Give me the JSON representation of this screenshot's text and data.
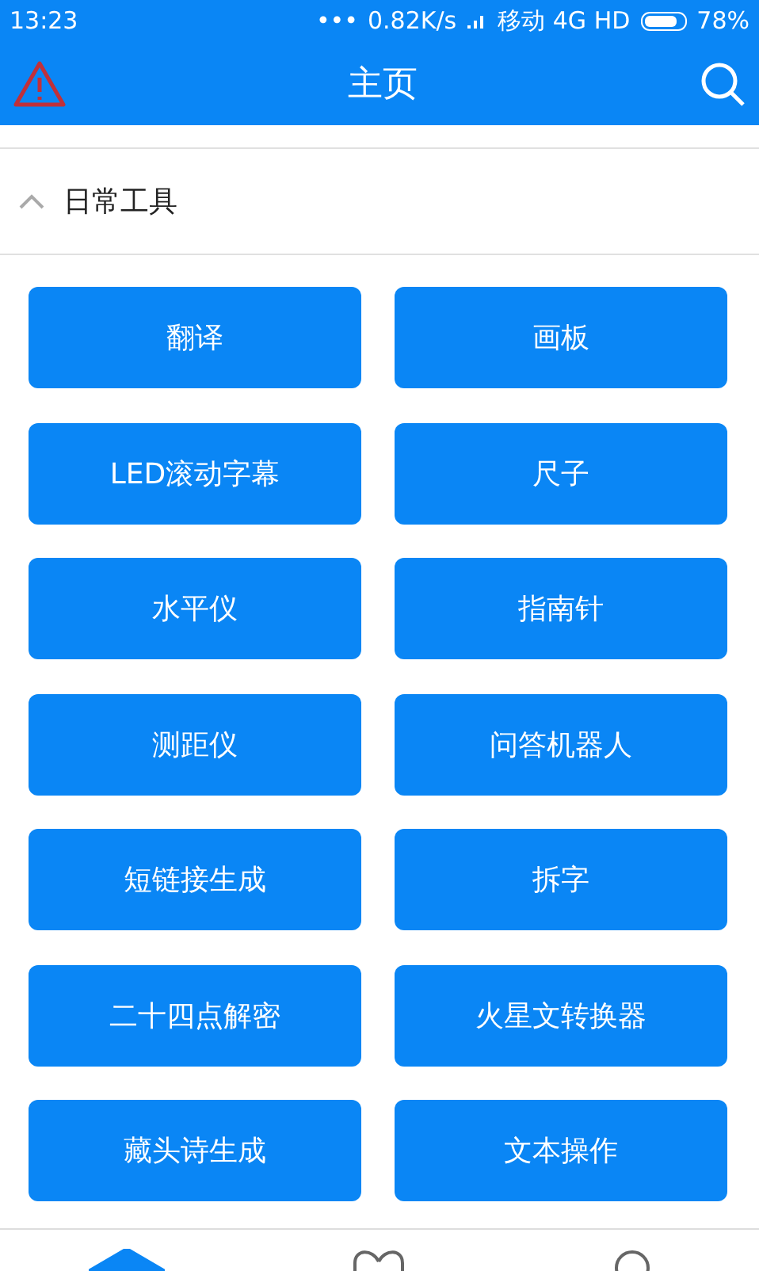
{
  "status_bar": {
    "time": "13:23",
    "dots": "•••",
    "speed": "0.82K/s",
    "carrier": "移动 4G HD",
    "battery": "78%"
  },
  "header": {
    "title": "主页"
  },
  "section": {
    "title": "日常工具",
    "expanded": true
  },
  "tools": [
    "翻译",
    "画板",
    "LED滚动字幕",
    "尺子",
    "水平仪",
    "指南针",
    "测距仪",
    "问答机器人",
    "短链接生成",
    "拆字",
    "二十四点解密",
    "火星文转换器",
    "藏头诗生成",
    "文本操作"
  ],
  "nav": [
    {
      "kind": "home",
      "selected": true
    },
    {
      "kind": "heart",
      "selected": false
    },
    {
      "kind": "person",
      "selected": false
    }
  ]
}
